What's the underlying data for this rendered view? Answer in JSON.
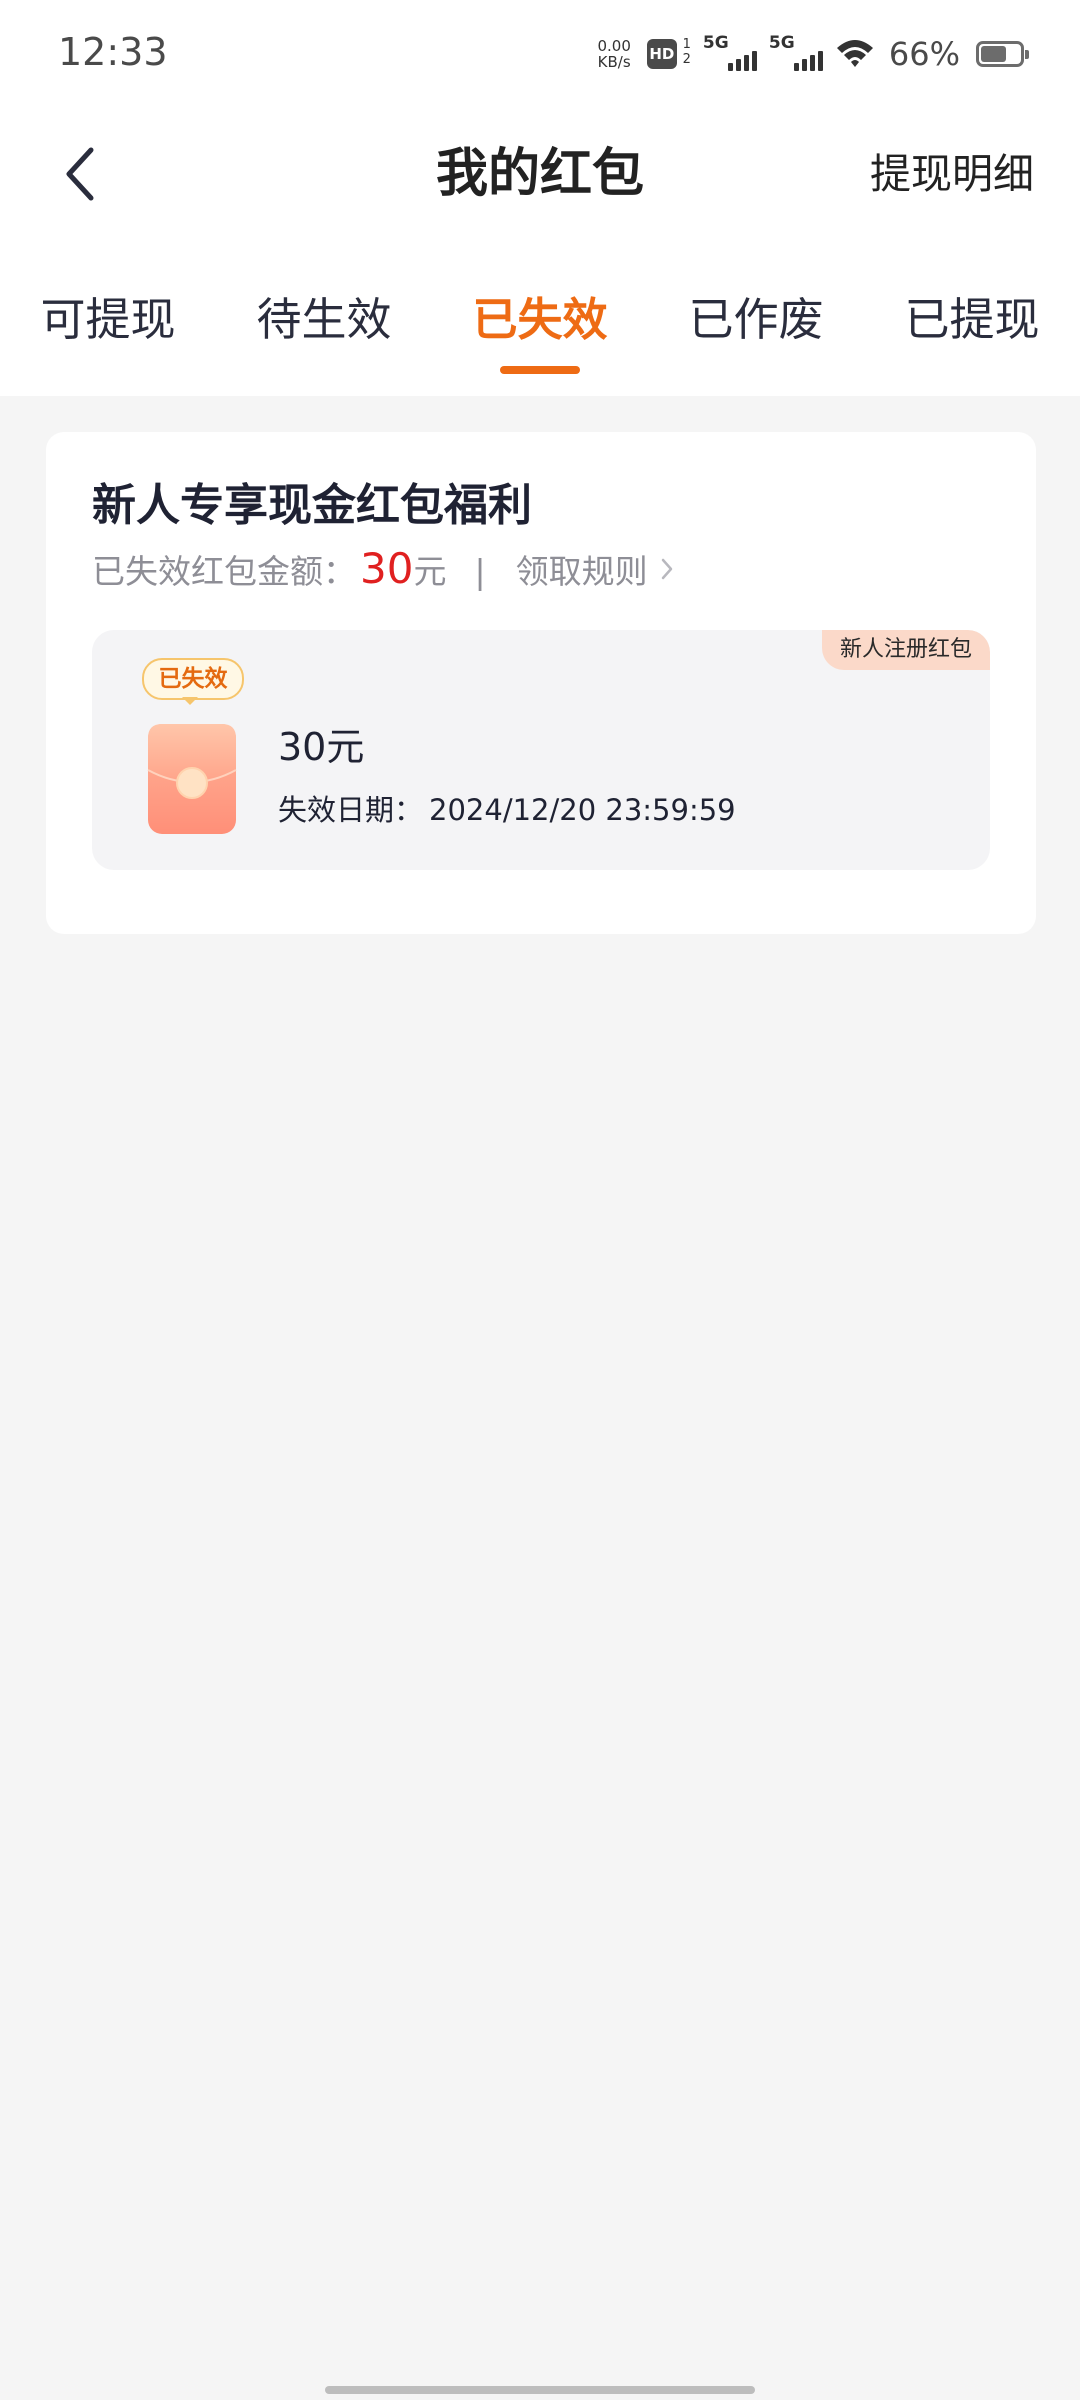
{
  "status_bar": {
    "time": "12:33",
    "net_speed_value": "0.00",
    "net_speed_unit": "KB/s",
    "hd_label": "HD",
    "hd_sim_top": "1",
    "hd_sim_bottom": "2",
    "network_1": "5G",
    "network_2": "5G",
    "battery_percent": "66%",
    "battery_level": 0.66
  },
  "header": {
    "title": "我的红包",
    "right_link": "提现明细"
  },
  "tabs": [
    {
      "label": "可提现",
      "active": false
    },
    {
      "label": "待生效",
      "active": false
    },
    {
      "label": "已失效",
      "active": true
    },
    {
      "label": "已作废",
      "active": false
    },
    {
      "label": "已提现",
      "active": false
    }
  ],
  "card": {
    "title": "新人专享现金红包福利",
    "summary_label": "已失效红包金额：",
    "summary_amount": "30",
    "summary_unit": "元",
    "separator": "|",
    "rules_link": "领取规则",
    "coupon": {
      "tag": "新人注册红包",
      "status": "已失效",
      "amount": "30元",
      "expiry_label": "失效日期：",
      "expiry_date": "2024/12/20 23:59:59"
    }
  },
  "colors": {
    "accent": "#ee6b14",
    "amount_red": "#e02020",
    "tag_bg": "#fbd9c9",
    "page_bg": "#f5f5f5"
  },
  "icons": {
    "back": "chevron-left-icon",
    "rules_arrow": "chevron-right-icon",
    "envelope": "red-envelope-icon",
    "wifi": "wifi-icon",
    "battery": "battery-icon"
  }
}
